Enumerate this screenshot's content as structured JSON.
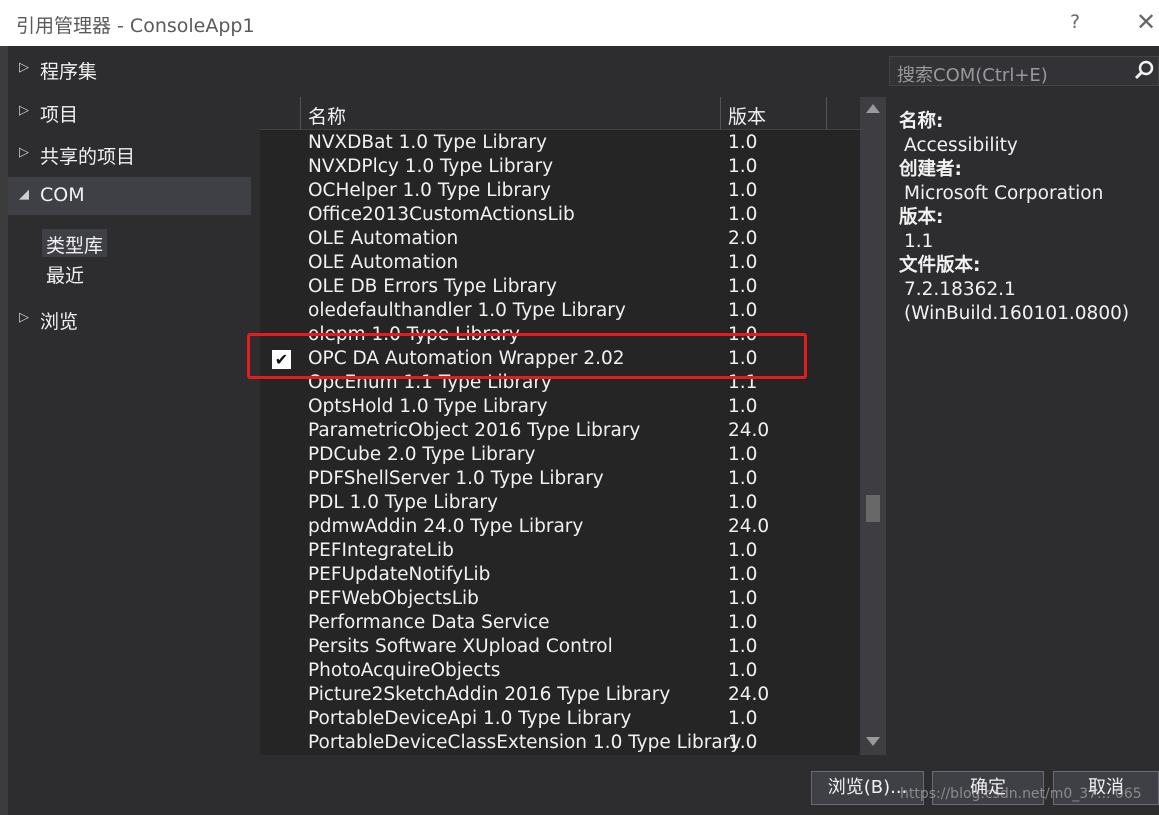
{
  "window": {
    "title": "引用管理器 - ConsoleApp1",
    "help": "?",
    "close": "✕"
  },
  "nav": {
    "items": [
      {
        "label": "程序集",
        "arrow": "▷"
      },
      {
        "label": "项目",
        "arrow": "▷"
      },
      {
        "label": "共享的项目",
        "arrow": "▷"
      },
      {
        "label": "COM",
        "arrow": "◢"
      },
      {
        "label": "浏览",
        "arrow": "▷"
      }
    ],
    "sub": [
      {
        "label": "类型库"
      },
      {
        "label": "最近"
      }
    ]
  },
  "list": {
    "headers": {
      "name": "名称",
      "version": "版本"
    },
    "rows": [
      {
        "name": "NVXDBat 1.0 Type Library",
        "version": "1.0"
      },
      {
        "name": "NVXDPlcy 1.0 Type Library",
        "version": "1.0"
      },
      {
        "name": "OCHelper 1.0 Type Library",
        "version": "1.0"
      },
      {
        "name": "Office2013CustomActionsLib",
        "version": "1.0"
      },
      {
        "name": "OLE Automation",
        "version": "2.0"
      },
      {
        "name": "OLE Automation",
        "version": "1.0"
      },
      {
        "name": "OLE DB Errors Type Library",
        "version": "1.0"
      },
      {
        "name": "oledefaulthandler 1.0 Type Library",
        "version": "1.0"
      },
      {
        "name": "olepm 1.0 Type Library",
        "version": "1.0"
      },
      {
        "name": "OPC DA Automation Wrapper 2.02",
        "version": "1.0",
        "checked": true
      },
      {
        "name": "OpcEnum 1.1 Type Library",
        "version": "1.1"
      },
      {
        "name": "OptsHold 1.0 Type Library",
        "version": "1.0"
      },
      {
        "name": "ParametricObject 2016 Type Library",
        "version": "24.0"
      },
      {
        "name": "PDCube 2.0 Type Library",
        "version": "1.0"
      },
      {
        "name": "PDFShellServer 1.0 Type Library",
        "version": "1.0"
      },
      {
        "name": "PDL 1.0 Type Library",
        "version": "1.0"
      },
      {
        "name": "pdmwAddin 24.0 Type Library",
        "version": "24.0"
      },
      {
        "name": "PEFIntegrateLib",
        "version": "1.0"
      },
      {
        "name": "PEFUpdateNotifyLib",
        "version": "1.0"
      },
      {
        "name": "PEFWebObjectsLib",
        "version": "1.0"
      },
      {
        "name": "Performance Data Service",
        "version": "1.0"
      },
      {
        "name": "Persits Software XUpload Control",
        "version": "1.0"
      },
      {
        "name": "PhotoAcquireObjects",
        "version": "1.0"
      },
      {
        "name": "Picture2SketchAddin 2016 Type Library",
        "version": "24.0"
      },
      {
        "name": "PortableDeviceApi 1.0 Type Library",
        "version": "1.0"
      },
      {
        "name": "PortableDeviceClassExtension 1.0 Type Library",
        "version": "1.0"
      }
    ],
    "checkmark": "✔"
  },
  "search": {
    "placeholder": "搜索COM(Ctrl+E)",
    "icon": "search-icon"
  },
  "details": {
    "name_label": "名称:",
    "name_value": "Accessibility",
    "creator_label": "创建者:",
    "creator_value": "Microsoft Corporation",
    "version_label": "版本:",
    "version_value": "1.1",
    "file_version_label": "文件版本:",
    "file_version_value": "7.2.18362.1",
    "file_version_build": "(WinBuild.160101.0800)"
  },
  "buttons": {
    "browse": "浏览(B)...",
    "ok": "确定",
    "cancel": "取消"
  },
  "watermark": "https://blog.csdn.net/m0_37... 065",
  "colors": {
    "background": "#2d2d30",
    "list_bg": "#252526",
    "highlight": "#e31d1d"
  }
}
